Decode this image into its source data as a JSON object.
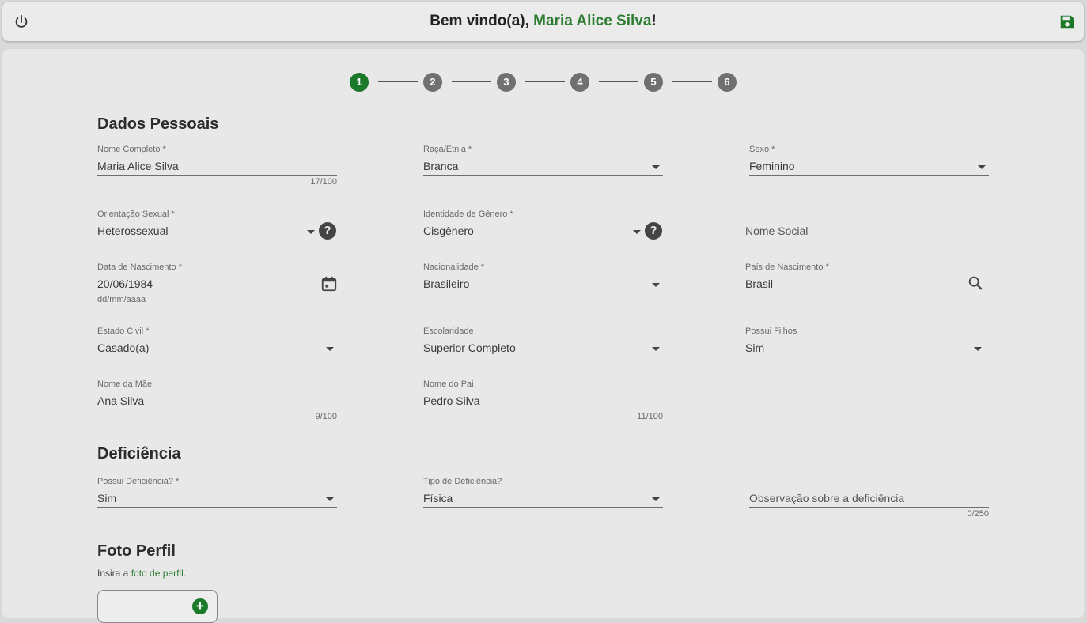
{
  "header": {
    "greeting": "Bem vindo(a), ",
    "user_name": "Maria Alice Silva",
    "suffix": "!"
  },
  "stepper": {
    "steps": [
      "1",
      "2",
      "3",
      "4",
      "5",
      "6"
    ],
    "active": 1
  },
  "sections": {
    "personal": "Dados Pessoais",
    "disability": "Deficiência",
    "photo": "Foto Perfil"
  },
  "fields": {
    "nome_completo": {
      "label": "Nome Completo *",
      "value": "Maria Alice Silva",
      "counter": "17/100"
    },
    "raca": {
      "label": "Raça/Etnia *",
      "value": "Branca"
    },
    "sexo": {
      "label": "Sexo *",
      "value": "Feminino"
    },
    "orientacao": {
      "label": "Orientação Sexual *",
      "value": "Heterossexual"
    },
    "identidade": {
      "label": "Identidade de Gênero *",
      "value": "Cisgênero"
    },
    "nome_social": {
      "placeholder": "Nome Social"
    },
    "nascimento": {
      "label": "Data de Nascimento *",
      "value": "20/06/1984",
      "hint": "dd/mm/aaaa"
    },
    "nacionalidade": {
      "label": "Nacionalidade *",
      "value": "Brasileiro"
    },
    "pais": {
      "label": "País de Nascimento *",
      "value": "Brasil"
    },
    "estado_civil": {
      "label": "Estado Civil *",
      "value": "Casado(a)"
    },
    "escolaridade": {
      "label": "Escolaridade",
      "value": "Superior Completo"
    },
    "filhos": {
      "label": "Possui Filhos",
      "value": "Sim"
    },
    "mae": {
      "label": "Nome da Mãe",
      "value": "Ana Silva",
      "counter": "9/100"
    },
    "pai": {
      "label": "Nome do Pai",
      "value": "Pedro Silva",
      "counter": "11/100"
    },
    "possui_deficiencia": {
      "label": "Possui Deficiência? *",
      "value": "Sim"
    },
    "tipo_deficiencia": {
      "label": "Tipo de Deficiência?",
      "value": "Física"
    },
    "obs_deficiencia": {
      "placeholder": "Observação sobre a deficiência",
      "counter": "0/250"
    }
  },
  "photo": {
    "intro": "Insira a ",
    "link": "foto de perfil",
    "end": "."
  },
  "help_symbol": "?",
  "add_symbol": "+",
  "colors": {
    "accent": "#2e7d32",
    "step_active": "#1b7a2a",
    "step_inactive": "#707070"
  }
}
